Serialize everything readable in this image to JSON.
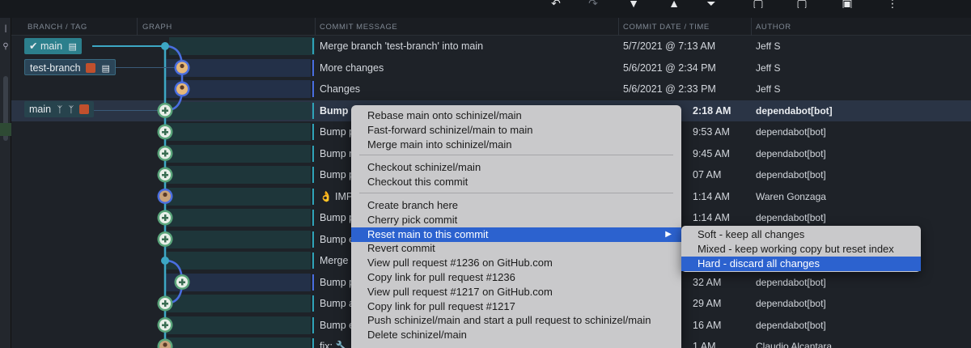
{
  "toolbar": {
    "icons": [
      "undo-icon",
      "redo-icon",
      "pull-icon",
      "push-icon",
      "branch-icon",
      "stash-icon",
      "pop-icon",
      "terminal-icon",
      "actions-icon"
    ]
  },
  "columns": {
    "branch": "BRANCH / TAG",
    "graph": "GRAPH",
    "message": "COMMIT MESSAGE",
    "date": "COMMIT DATE / TIME",
    "author": "AUTHOR"
  },
  "branches": {
    "main_active": "main",
    "test": "test-branch",
    "remote_main": "main"
  },
  "rows": [
    {
      "message": "Merge branch 'test-branch' into main",
      "date": "5/7/2021 @ 7:13 AM",
      "author": "Jeff S"
    },
    {
      "message": "More changes",
      "date": "5/6/2021 @ 2:34 PM",
      "author": "Jeff S"
    },
    {
      "message": "Changes",
      "date": "5/6/2021 @ 2:33 PM",
      "author": "Jeff S"
    },
    {
      "message": "Bump e",
      "date": "2:18 AM",
      "author": "dependabot[bot]"
    },
    {
      "message": "Bump p",
      "date": "9:53 AM",
      "author": "dependabot[bot]"
    },
    {
      "message": "Bump n",
      "date": "9:45 AM",
      "author": "dependabot[bot]"
    },
    {
      "message": "Bump p",
      "date": "07 AM",
      "author": "dependabot[bot]"
    },
    {
      "message": "👌 IMP",
      "date": "1:14 AM",
      "author": "Waren Gonzaga"
    },
    {
      "message": "Bump p",
      "date": "1:14 AM",
      "author": "dependabot[bot]"
    },
    {
      "message": "Bump e",
      "date": "1:14 AM",
      "author": "dependabot[bot]"
    },
    {
      "message": "Merge p",
      "date": "",
      "author": ""
    },
    {
      "message": "Bump p",
      "date": "32 AM",
      "author": "dependabot[bot]"
    },
    {
      "message": "Bump a",
      "date": "29 AM",
      "author": "dependabot[bot]"
    },
    {
      "message": "Bump e",
      "date": "16 AM",
      "author": "dependabot[bot]"
    },
    {
      "message": "fix: 🔧 a",
      "date": "1 AM",
      "author": "Claudio Alcantara"
    }
  ],
  "context_menu": {
    "items": [
      "Rebase main onto schinizel/main",
      "Fast-forward schinizel/main to main",
      "Merge main into schinizel/main",
      "Checkout schinizel/main",
      "Checkout this commit",
      "Create branch here",
      "Cherry pick commit",
      "Reset main to this commit",
      "Revert commit",
      "View pull request #1236 on GitHub.com",
      "Copy link for pull request #1236",
      "View pull request #1217 on GitHub.com",
      "Copy link for pull request #1217",
      "Push schinizel/main and start a pull request to schinizel/main",
      "Delete schinizel/main"
    ],
    "submenu_arrow": "▶"
  },
  "submenu": {
    "items": [
      "Soft - keep all changes",
      "Mixed - keep working copy but reset index",
      "Hard - discard all changes"
    ]
  },
  "colors": {
    "accent": "#2c62cf",
    "graph_line": "#3da7c4",
    "branch_active": "#2c7f8c",
    "menu_bg": "#c9c9cb"
  }
}
